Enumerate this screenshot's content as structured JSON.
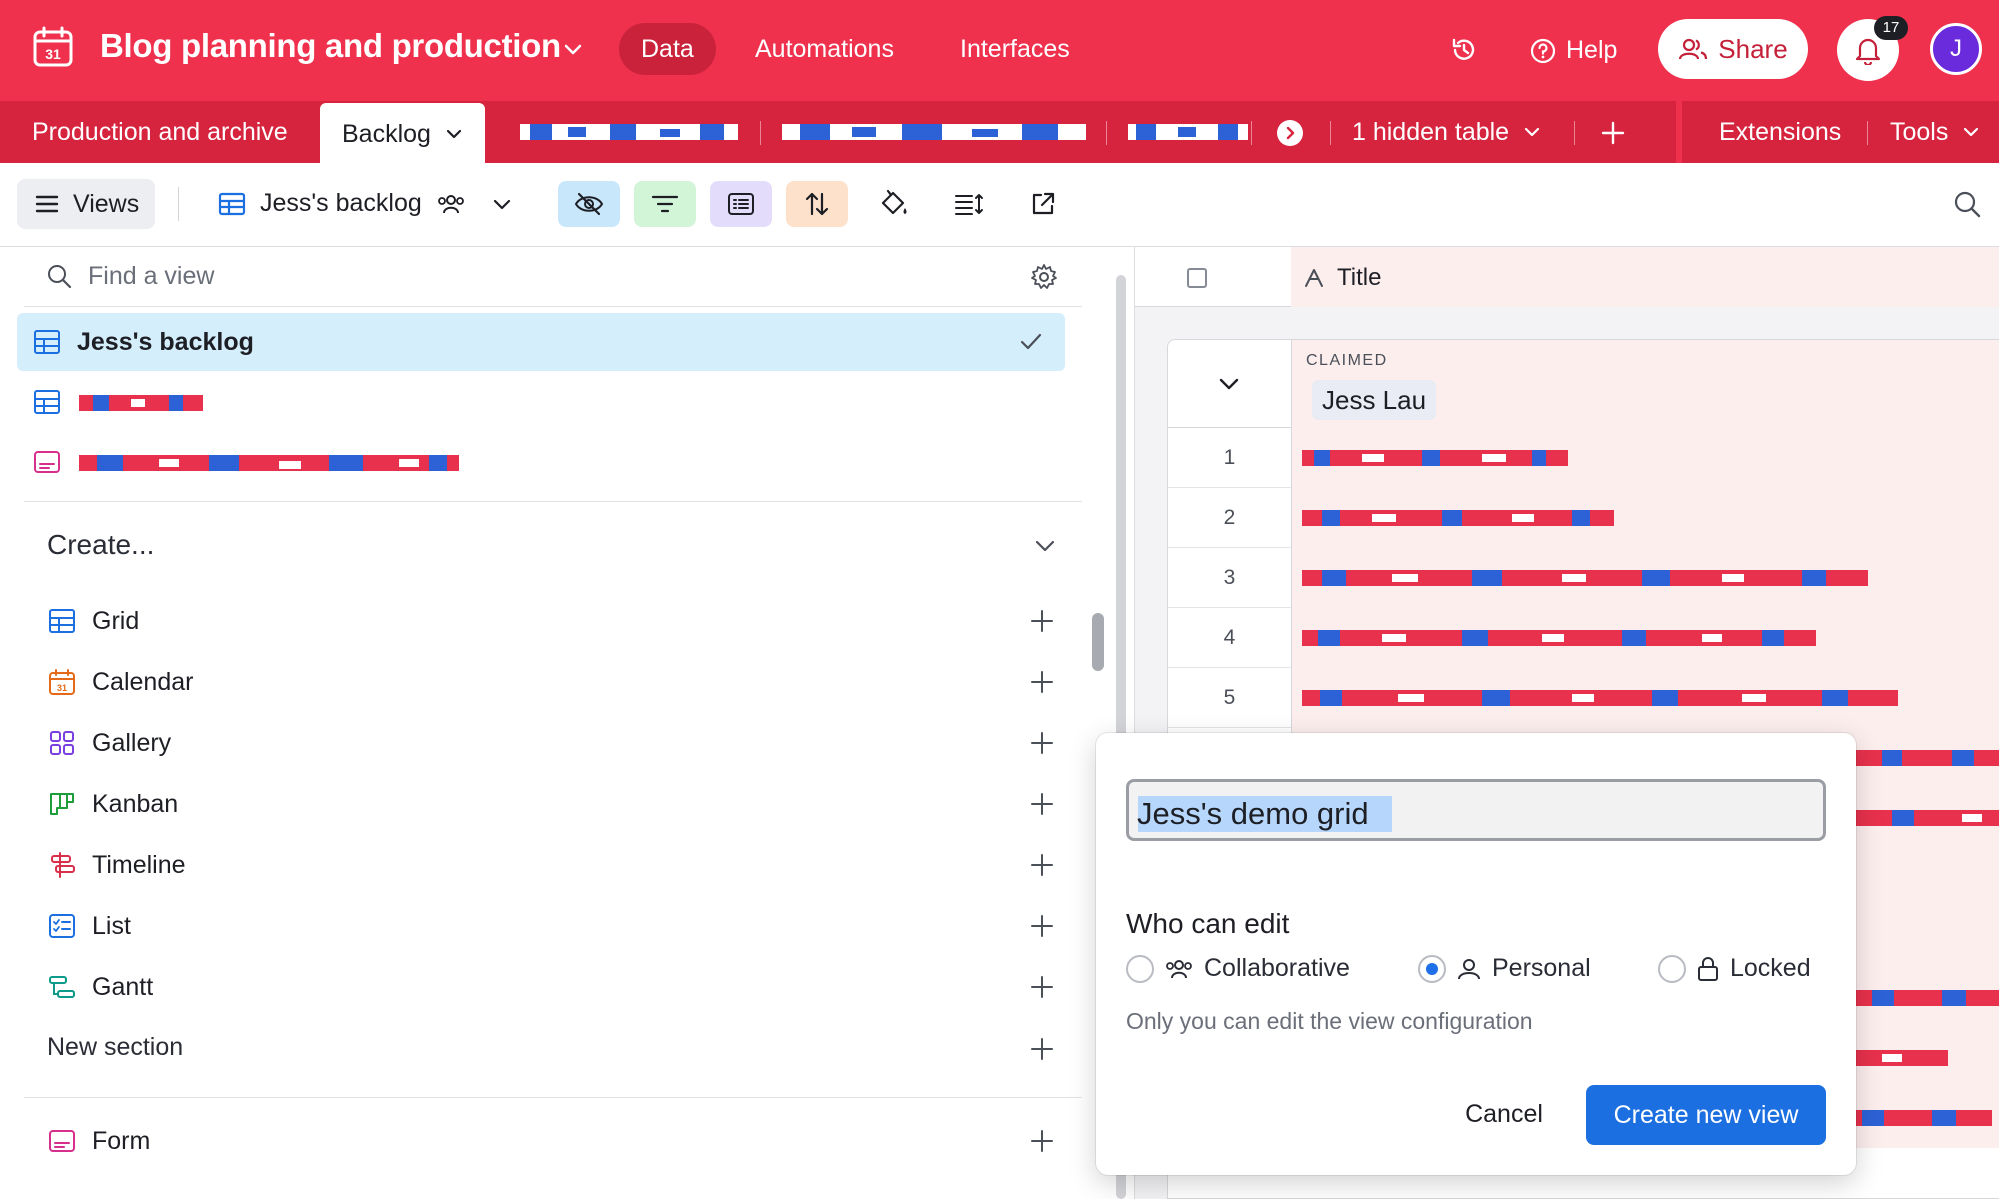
{
  "app": {
    "base_title": "Blog planning and production",
    "nav": [
      "Data",
      "Automations",
      "Interfaces"
    ],
    "help_label": "Help",
    "share_label": "Share",
    "notifications_count": "17",
    "avatar_initial": "J"
  },
  "tables": {
    "first": "Production and archive",
    "active": "Backlog",
    "hidden_tables": "1 hidden table",
    "extensions": "Extensions",
    "tools": "Tools"
  },
  "toolbar": {
    "views_label": "Views",
    "current_view": "Jess's backlog"
  },
  "views_panel": {
    "find_placeholder": "Find a view",
    "selected_view": "Jess's backlog",
    "create_heading": "Create...",
    "create_items": [
      "Grid",
      "Calendar",
      "Gallery",
      "Kanban",
      "Timeline",
      "List",
      "Gantt"
    ],
    "new_section": "New section",
    "form_label": "Form"
  },
  "grid": {
    "title_column": "Title",
    "group_field": "CLAIMED",
    "group_value": "Jess Lau",
    "row_numbers": [
      "1",
      "2",
      "3",
      "4",
      "5"
    ]
  },
  "popover": {
    "view_name": "Jess's demo grid",
    "who_can_edit": "Who can edit",
    "options": [
      "Collaborative",
      "Personal",
      "Locked"
    ],
    "selected_option": "Personal",
    "help_text": "Only you can edit the view configuration",
    "cancel_label": "Cancel",
    "create_label": "Create new view"
  },
  "colors": {
    "brand": "#ef314e",
    "brand_dark": "#d6243f",
    "primary_button": "#1b6fe0",
    "selected_view_bg": "#d5eefc"
  }
}
